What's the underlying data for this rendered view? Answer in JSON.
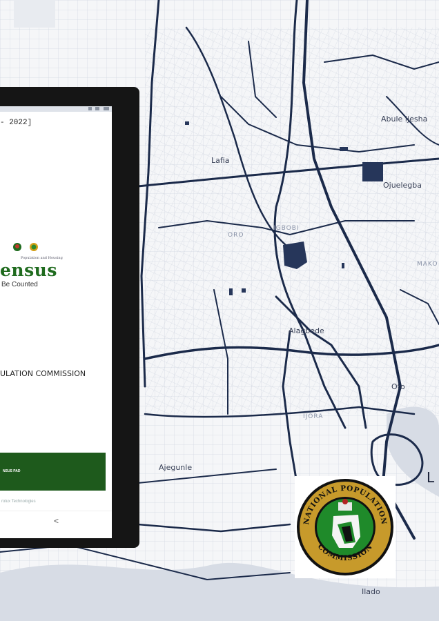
{
  "map": {
    "labels": [
      "Lafia",
      "Abule Ijesha",
      "Ojuelegba",
      "Alagbede",
      "Oto",
      "IJORA",
      "Ajegunle",
      "Ilado",
      "MAKO",
      "ORO",
      "IGBOBI",
      "L"
    ]
  },
  "tablet": {
    "header_text": "- 2022]",
    "census": {
      "title": "ensus",
      "subtitle": "Population and Housing",
      "tagline": "Be Counted"
    },
    "org_name": "ULATION COMMISSION",
    "start_button_label": "NSUS PAD",
    "footer": "rolux Technologies",
    "nav_back": "<"
  },
  "npc_logo": {
    "top_text": "NATIONAL POPULATION",
    "bottom_text": "COMMISSION",
    "colors": {
      "green": "#1f8a2a",
      "gold": "#c79a2b",
      "black": "#111111"
    }
  },
  "colors": {
    "road": "#1b2a4a",
    "census_green": "#1f6b1e",
    "button_green": "#1e5a1c"
  }
}
